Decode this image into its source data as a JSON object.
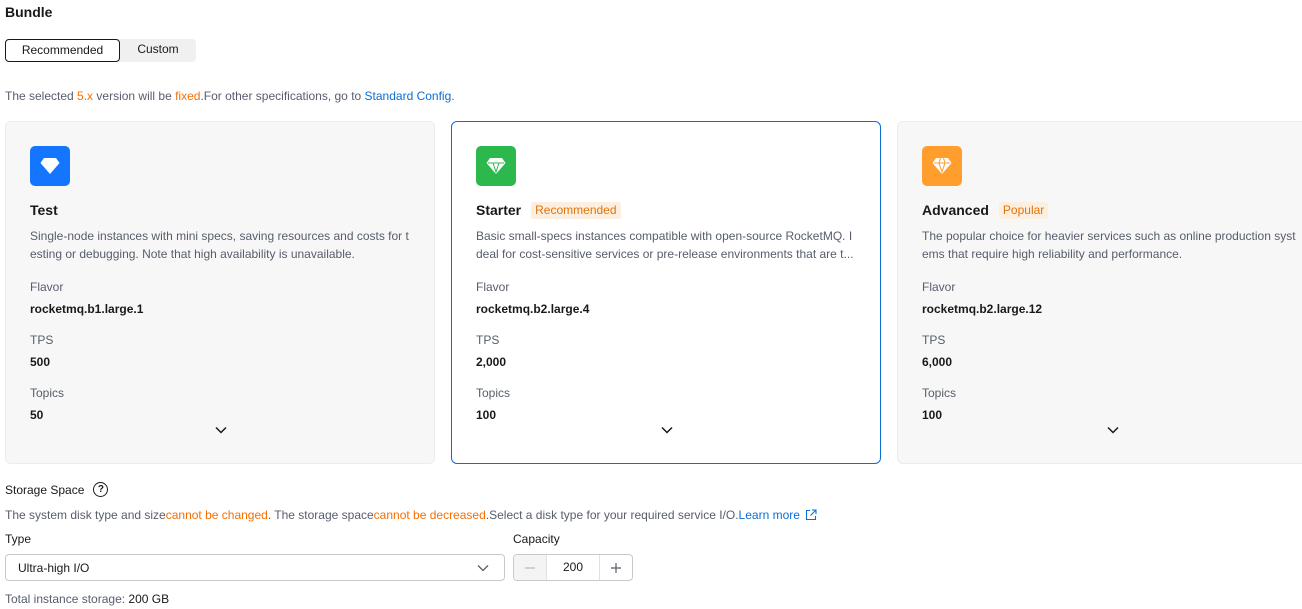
{
  "bundle": {
    "title": "Bundle",
    "tabs": {
      "recommended": "Recommended",
      "custom": "Custom"
    },
    "notice": {
      "p1": "The selected ",
      "version": "5.x",
      "p2": " version will be ",
      "fixed": "fixed",
      "p3": ".For other specifications, go to ",
      "link": "Standard Config",
      "p4": "."
    }
  },
  "cards": [
    {
      "name": "Test",
      "tag": "",
      "icon": "diamond-icon",
      "icon_color": "#1476ff",
      "description": "Single-node instances with mini specs, saving resources and costs for testing or debugging. Note that high availability is unavailable.",
      "flavor_label": "Flavor",
      "flavor": "rocketmq.b1.large.1",
      "tps_label": "TPS",
      "tps": "500",
      "topics_label": "Topics",
      "topics": "50"
    },
    {
      "name": "Starter",
      "tag": "Recommended",
      "icon": "diamond-icon",
      "icon_color": "#2db84d",
      "description": "Basic small-specs instances compatible with open-source RocketMQ. Ideal for cost-sensitive services or pre-release environments that are t...",
      "flavor_label": "Flavor",
      "flavor": "rocketmq.b2.large.4",
      "tps_label": "TPS",
      "tps": "2,000",
      "topics_label": "Topics",
      "topics": "100"
    },
    {
      "name": "Advanced",
      "tag": "Popular",
      "icon": "diamond-icon",
      "icon_color": "#ff9e2c",
      "description": "The popular choice for heavier services such as online production systems that require high reliability and performance.",
      "flavor_label": "Flavor",
      "flavor": "rocketmq.b2.large.12",
      "tps_label": "TPS",
      "tps": "6,000",
      "topics_label": "Topics",
      "topics": "100"
    }
  ],
  "storage": {
    "label": "Storage Space",
    "notice": {
      "p1": "The system disk type and size ",
      "changed": "cannot be changed",
      "p2": ". The storage space ",
      "decreased": "cannot be decreased",
      "p3": ".Select a disk type for your required service I/O. ",
      "link": "Learn more"
    },
    "type_label": "Type",
    "type_value": "Ultra-high I/O",
    "capacity_label": "Capacity",
    "capacity_value": "200",
    "total_label": "Total instance storage: ",
    "total_value": "200 GB"
  },
  "colors": {
    "accent": "#0a6ed4",
    "warning": "#f66f00",
    "tag_text": "#e2730b",
    "tag_bg": "#fdefdf"
  }
}
